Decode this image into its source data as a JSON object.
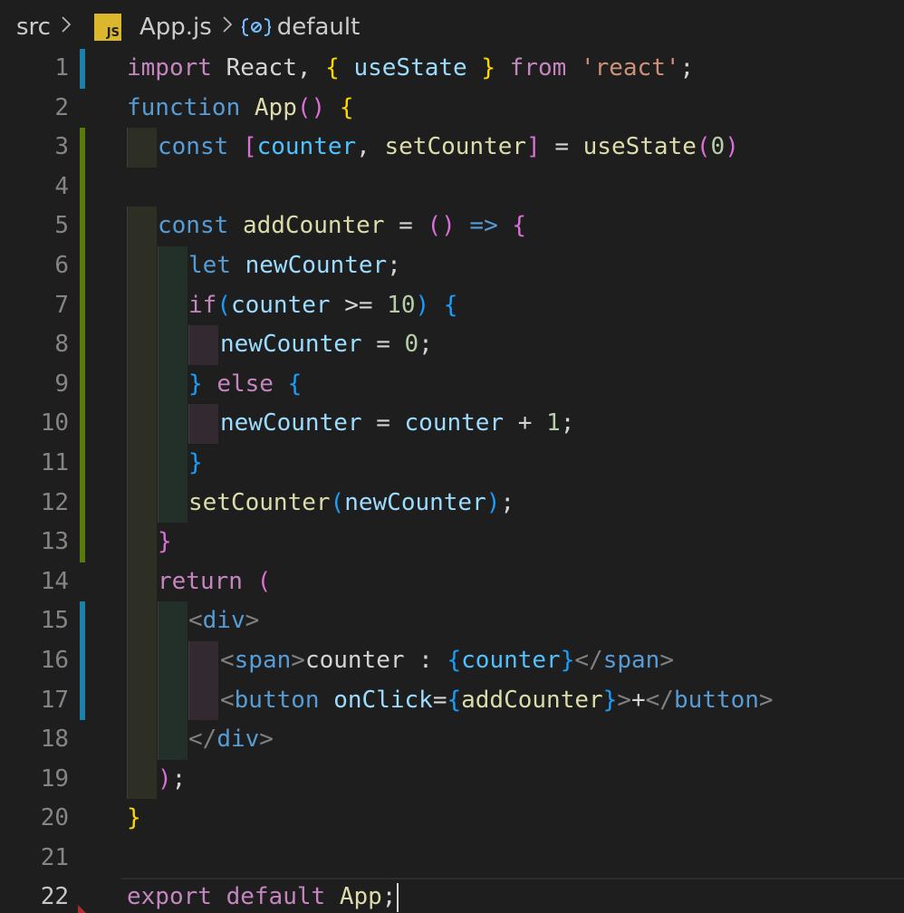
{
  "breadcrumb": {
    "folder": "src",
    "file": "App.js",
    "file_icon_label": "JS",
    "symbol": "default",
    "separator_icon": "chevron-right-icon",
    "symbol_icon": "symbol-namespace-icon"
  },
  "editor": {
    "active_line": 22,
    "language": "javascript",
    "line_numbers": [
      "1",
      "2",
      "3",
      "4",
      "5",
      "6",
      "7",
      "8",
      "9",
      "10",
      "11",
      "12",
      "13",
      "14",
      "15",
      "16",
      "17",
      "18",
      "19",
      "20",
      "21",
      "22"
    ],
    "gutter_colors": {
      "modified": "#1b81a8",
      "added": "#587c0c"
    }
  },
  "code": {
    "l1": [
      "import",
      " React, ",
      "{",
      " useState ",
      "}",
      " from ",
      "'react'",
      ";"
    ],
    "l2": [
      "function",
      " ",
      "App",
      "()",
      " ",
      "{"
    ],
    "l3": [
      "const",
      " ",
      "[",
      "counter",
      ", ",
      "setCounter",
      "]",
      " = ",
      "useState",
      "(",
      "0",
      ")"
    ],
    "l5": [
      "const",
      " ",
      "addCounter",
      " = ",
      "()",
      " ",
      "=>",
      " ",
      "{"
    ],
    "l6": [
      "let",
      " ",
      "newCounter",
      ";"
    ],
    "l7": [
      "if",
      "(",
      "counter",
      " >= ",
      "10",
      ")",
      " ",
      "{"
    ],
    "l8": [
      "newCounter",
      " = ",
      "0",
      ";"
    ],
    "l9": [
      "}",
      " ",
      "else",
      " ",
      "{"
    ],
    "l10": [
      "newCounter",
      " = ",
      "counter",
      " + ",
      "1",
      ";"
    ],
    "l11": [
      "}"
    ],
    "l12": [
      "setCounter",
      "(",
      "newCounter",
      ")",
      ";"
    ],
    "l13": [
      "}"
    ],
    "l14": [
      "return",
      " ",
      "("
    ],
    "l15": [
      "<",
      "div",
      ">"
    ],
    "l16": [
      "<",
      "span",
      ">",
      "counter : ",
      "{",
      "counter",
      "}",
      "</",
      "span",
      ">"
    ],
    "l17": [
      "<",
      "button",
      " ",
      "onClick",
      "=",
      "{",
      "addCounter",
      "}",
      ">",
      "+",
      "</",
      "button",
      ">"
    ],
    "l18": [
      "</",
      "div",
      ">"
    ],
    "l19": [
      ")",
      ";"
    ],
    "l20": [
      "}"
    ],
    "l22": [
      "export",
      " ",
      "default",
      " ",
      "App",
      ";"
    ]
  }
}
